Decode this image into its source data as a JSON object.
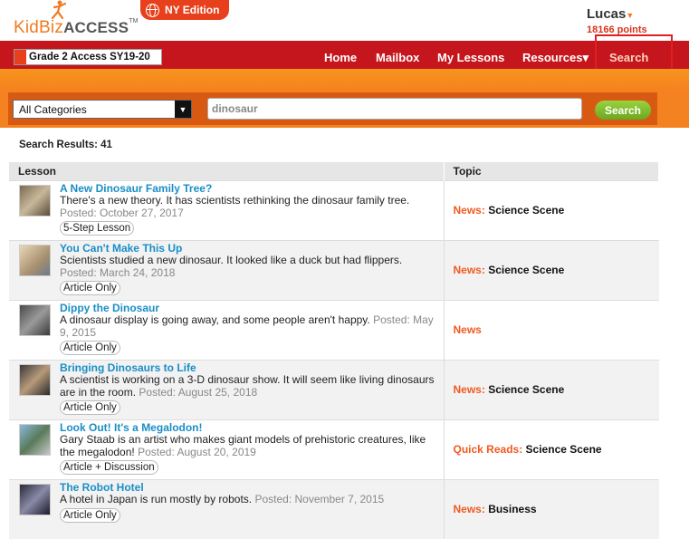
{
  "header": {
    "logo_kid": "KidBiz",
    "logo_access": "ACCESS",
    "logo_tm": "TM",
    "edition": "NY Edition",
    "user_name": "Lucas",
    "points": "18166 points"
  },
  "nav": {
    "class_name": "Grade 2 Access SY19-20",
    "items": [
      "Home",
      "Mailbox",
      "My Lessons",
      "Resources▾",
      "Search"
    ]
  },
  "search": {
    "category": "All Categories",
    "query": "dinosaur",
    "button": "Search"
  },
  "results": {
    "count_label": "Search Results: 41",
    "columns": [
      "Lesson",
      "Topic"
    ],
    "rows": [
      {
        "title": "A New Dinosaur Family Tree?",
        "desc": "There's a new theory. It has scientists rethinking the dinosaur family tree.",
        "posted": "Posted: October 27, 2017",
        "badge": "5-Step Lesson",
        "topic": "News:",
        "subtopic": "Science Scene"
      },
      {
        "title": "You Can't Make This Up",
        "desc": "Scientists studied a new dinosaur. It looked like a duck but had flippers.",
        "posted": "Posted: March 24, 2018",
        "badge": "Article Only",
        "topic": "News:",
        "subtopic": "Science Scene"
      },
      {
        "title": "Dippy the Dinosaur",
        "desc": "A dinosaur display is going away, and some people aren't happy.",
        "posted": "Posted: May 9, 2015",
        "badge": "Article Only",
        "topic": "News",
        "subtopic": ""
      },
      {
        "title": "Bringing Dinosaurs to Life",
        "desc": "A scientist is working on a 3-D dinosaur show. It will seem like living dinosaurs are in the room.",
        "posted": "Posted: August 25, 2018",
        "badge": "Article Only",
        "topic": "News:",
        "subtopic": "Science Scene"
      },
      {
        "title": "Look Out! It's a Megalodon!",
        "desc": "Gary Staab is an artist who makes giant models of prehistoric creatures, like the megalodon!",
        "posted": "Posted: August 20, 2019",
        "badge": "Article + Discussion",
        "topic": "Quick Reads:",
        "subtopic": "Science Scene"
      },
      {
        "title": "The Robot Hotel",
        "desc": "A hotel in Japan is run mostly by robots.",
        "posted": "Posted: November 7, 2015",
        "badge": "Article Only",
        "topic": "News:",
        "subtopic": "Business"
      }
    ]
  },
  "colors": {
    "brand_orange": "#f58220",
    "nav_red": "#c4161c",
    "link_blue": "#1a8ec6",
    "highlight": "#e02020"
  }
}
